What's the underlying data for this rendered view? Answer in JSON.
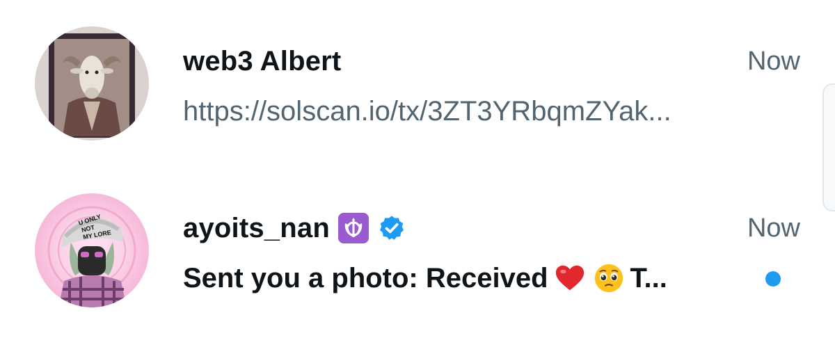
{
  "conversations": [
    {
      "display_name": "web3 Albert",
      "timestamp": "Now",
      "snippet": "https://solscan.io/tx/3ZT3YRbqmZYak...",
      "unread": false,
      "avatar_icon": "goat-portrait-avatar"
    },
    {
      "display_name": "ayoits_nan",
      "timestamp": "Now",
      "snippet_text": "Sent you a photo: Received",
      "snippet_tail": "T...",
      "snippet_emojis": [
        "red-heart-icon",
        "pleading-face-icon"
      ],
      "name_emoji": "khanda-icon",
      "verified": true,
      "verified_color": "#1d9bf0",
      "unread": true,
      "avatar_icon": "cap-character-avatar"
    }
  ],
  "colors": {
    "name": "#0f1419",
    "secondary_text": "#536471",
    "unread_dot": "#1d9bf0",
    "badge_purple": "#9a5bd1"
  }
}
